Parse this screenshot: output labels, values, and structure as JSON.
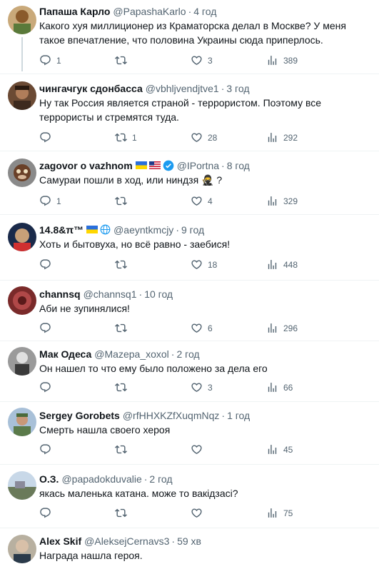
{
  "icons": {
    "reply": "reply-icon",
    "retweet": "retweet-icon",
    "like": "heart-icon",
    "views": "views-icon",
    "verified": "verified-badge-icon"
  },
  "colors": {
    "text": "#0f1419",
    "secondary": "#536471",
    "divider": "#eff3f4",
    "verified": "#1d9bf0"
  },
  "tweets": [
    {
      "name": "Папаша Карло",
      "handle": "@PapashaKarlo",
      "time": "4 год",
      "text": "Какого хуя миллиционер из Краматорска делал в Москве? У меня такое впечатление, что половина Украины сюда приперлось.",
      "replies": "1",
      "retweets": "",
      "likes": "3",
      "views": "389"
    },
    {
      "name": "чингачгук сдонбасса",
      "handle": "@vbhljvendjtve1",
      "time": "3 год",
      "text": "Ну так Россия является страной - террористом. Поэтому все террористы и стремятся туда.",
      "replies": "",
      "retweets": "1",
      "likes": "28",
      "views": "292"
    },
    {
      "name": "zagovor o vazhnom",
      "handle": "@IPortna",
      "time": "8 год",
      "text": "Самураи пошли в ход, или ниндзя 🥷 ?",
      "replies": "1",
      "retweets": "",
      "likes": "4",
      "views": "329"
    },
    {
      "name": "14.8&π™",
      "handle": "@aeyntkmcjy",
      "time": "9 год",
      "text": "Хоть и бытовуха, но всё равно - заебися!",
      "replies": "",
      "retweets": "",
      "likes": "18",
      "views": "448"
    },
    {
      "name": "channsq",
      "handle": "@channsq1",
      "time": "10 год",
      "text": "Аби не зупинялися!",
      "replies": "",
      "retweets": "",
      "likes": "6",
      "views": "296"
    },
    {
      "name": "Мак Одеса",
      "handle": "@Mazepa_xoxol",
      "time": "2 год",
      "text": "Он нашел то что ему было положено за дела его",
      "replies": "",
      "retweets": "",
      "likes": "3",
      "views": "66"
    },
    {
      "name": "Sergey Gorobets",
      "handle": "@rfHHXKZfXuqmNqz",
      "time": "1 год",
      "text": "Смерть нашла своего хероя",
      "replies": "",
      "retweets": "",
      "likes": "",
      "views": "45"
    },
    {
      "name": "О.З.",
      "handle": "@papadokduvalie",
      "time": "2 год",
      "text": "якась маленька катана. може то вакідзасі?",
      "replies": "",
      "retweets": "",
      "likes": "",
      "views": "75"
    },
    {
      "name": "Alex Skif",
      "handle": "@AleksejCernavs3",
      "time": "59 хв",
      "text": "Награда нашла героя.",
      "replies": "",
      "retweets": "",
      "likes": "",
      "views": ""
    }
  ]
}
